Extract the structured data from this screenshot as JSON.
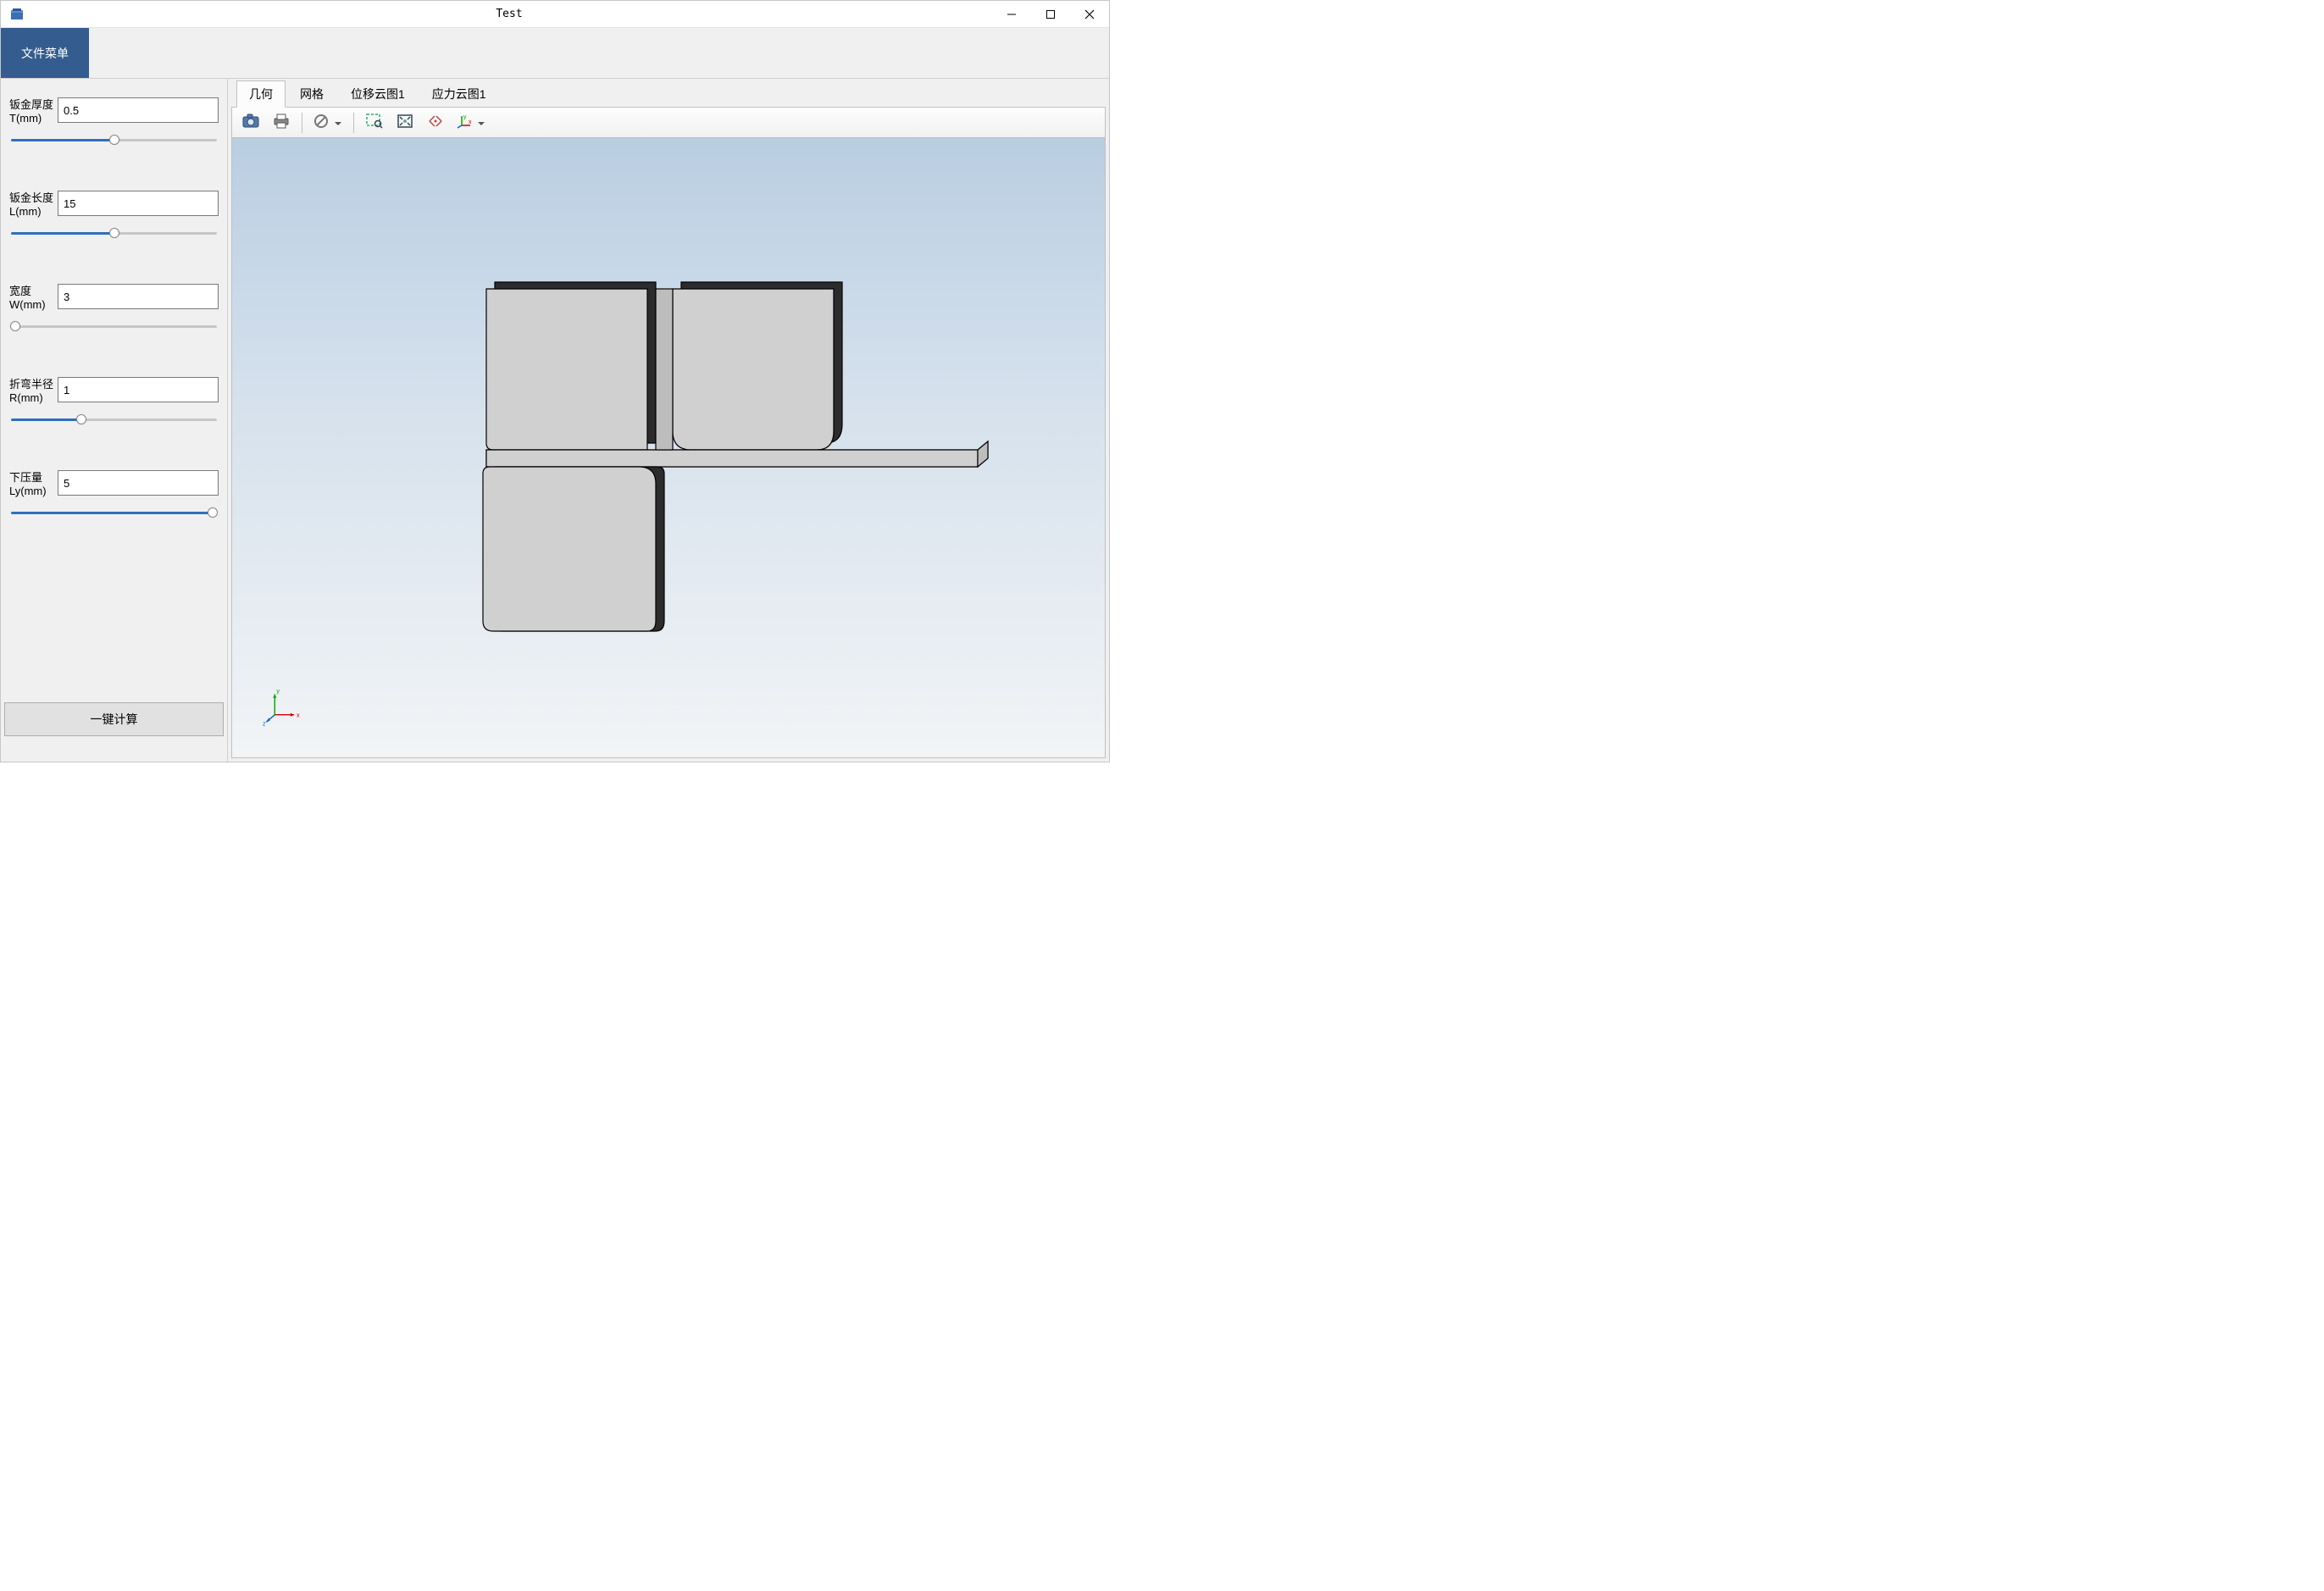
{
  "window": {
    "title": "Test"
  },
  "menu": {
    "file_menu_label": "文件菜单"
  },
  "sidebar": {
    "params": [
      {
        "label": "钣金厚度T(mm)",
        "value": "0.5",
        "slider_pct": 50
      },
      {
        "label": "钣金长度L(mm)",
        "value": "15",
        "slider_pct": 50
      },
      {
        "label": "宽度W(mm)",
        "value": "3",
        "slider_pct": 2
      },
      {
        "label": "折弯半径R(mm)",
        "value": "1",
        "slider_pct": 34
      },
      {
        "label": "下压量Ly(mm)",
        "value": "5",
        "slider_pct": 98
      }
    ],
    "calc_button_label": "一键计算"
  },
  "tabs": [
    {
      "label": "几何",
      "active": true
    },
    {
      "label": "网格",
      "active": false
    },
    {
      "label": "位移云图1",
      "active": false
    },
    {
      "label": "应力云图1",
      "active": false
    }
  ],
  "toolbar": {
    "icons": [
      {
        "name": "camera-icon"
      },
      {
        "name": "print-icon"
      },
      {
        "name": "sep"
      },
      {
        "name": "nosign-icon",
        "dropdown": true
      },
      {
        "name": "sep"
      },
      {
        "name": "zoom-area-icon"
      },
      {
        "name": "fit-view-icon"
      },
      {
        "name": "reset-view-icon"
      },
      {
        "name": "axis-triad-icon",
        "dropdown": true
      }
    ]
  },
  "triad": {
    "x_label": "x",
    "y_label": "y",
    "z_label": "z"
  }
}
